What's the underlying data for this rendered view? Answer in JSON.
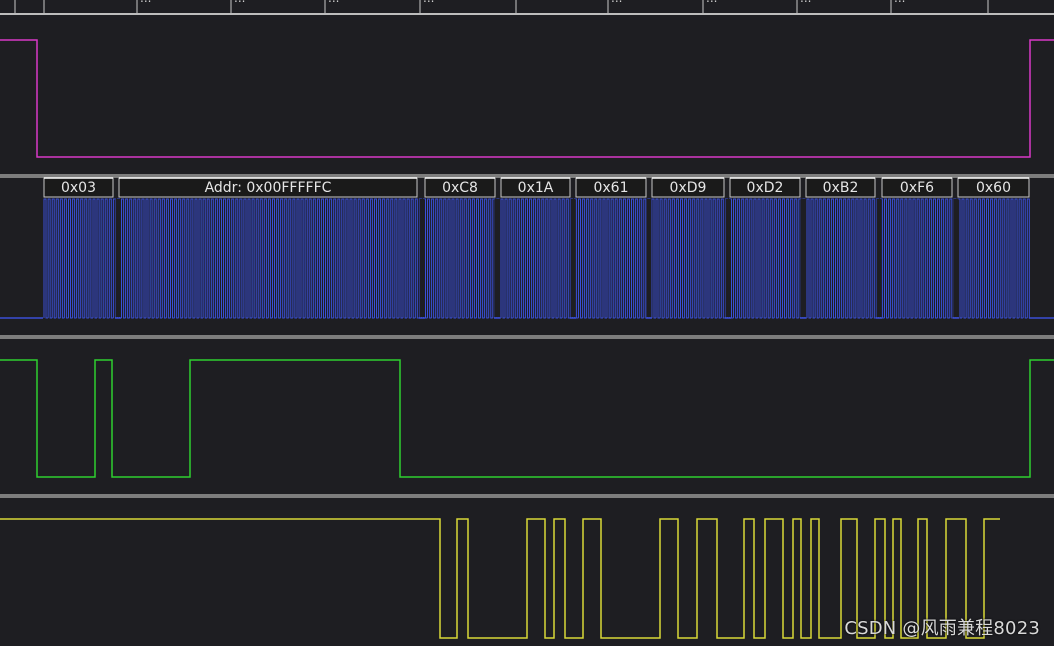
{
  "ruler": {
    "labels": [
      "...",
      "...",
      "...",
      "...",
      "...",
      "...",
      "...",
      "..."
    ]
  },
  "decode_labels": [
    "0x03",
    "Addr: 0x00FFFFFC",
    "0xC8",
    "0x1A",
    "0x61",
    "0xD9",
    "0xD2",
    "0xB2",
    "0xF6",
    "0x60"
  ],
  "colors": {
    "background": "#1e1e22",
    "channel_divider": "#7d7d7d",
    "cs": "#d838c8",
    "clk": "#3a4fd6",
    "mosi": "#2fcf2f",
    "miso": "#d8d838",
    "decode_box": "#1a1a1a",
    "decode_border": "#c8c8c8",
    "decode_text": "#e6e6e6"
  },
  "watermark": "CSDN @风雨兼程8023"
}
